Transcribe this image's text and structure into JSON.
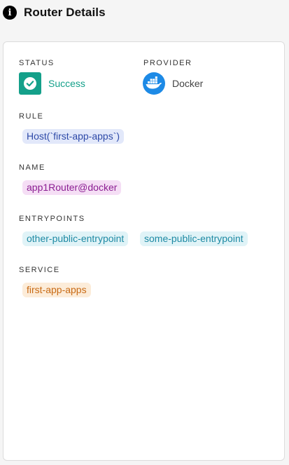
{
  "header": {
    "icon": "info-icon",
    "title": "Router Details"
  },
  "status": {
    "label": "STATUS",
    "value": "Success",
    "icon": "check-icon",
    "color": "#14a08a"
  },
  "provider": {
    "label": "PROVIDER",
    "value": "Docker",
    "icon": "docker-icon",
    "color": "#1d8ae6"
  },
  "rule": {
    "label": "RULE",
    "value": "Host(`first-app-apps`)"
  },
  "name": {
    "label": "NAME",
    "value": "app1Router@docker"
  },
  "entrypoints": {
    "label": "ENTRYPOINTS",
    "items": [
      "other-public-entrypoint",
      "some-public-entrypoint"
    ]
  },
  "service": {
    "label": "SERVICE",
    "value": "first-app-apps"
  }
}
